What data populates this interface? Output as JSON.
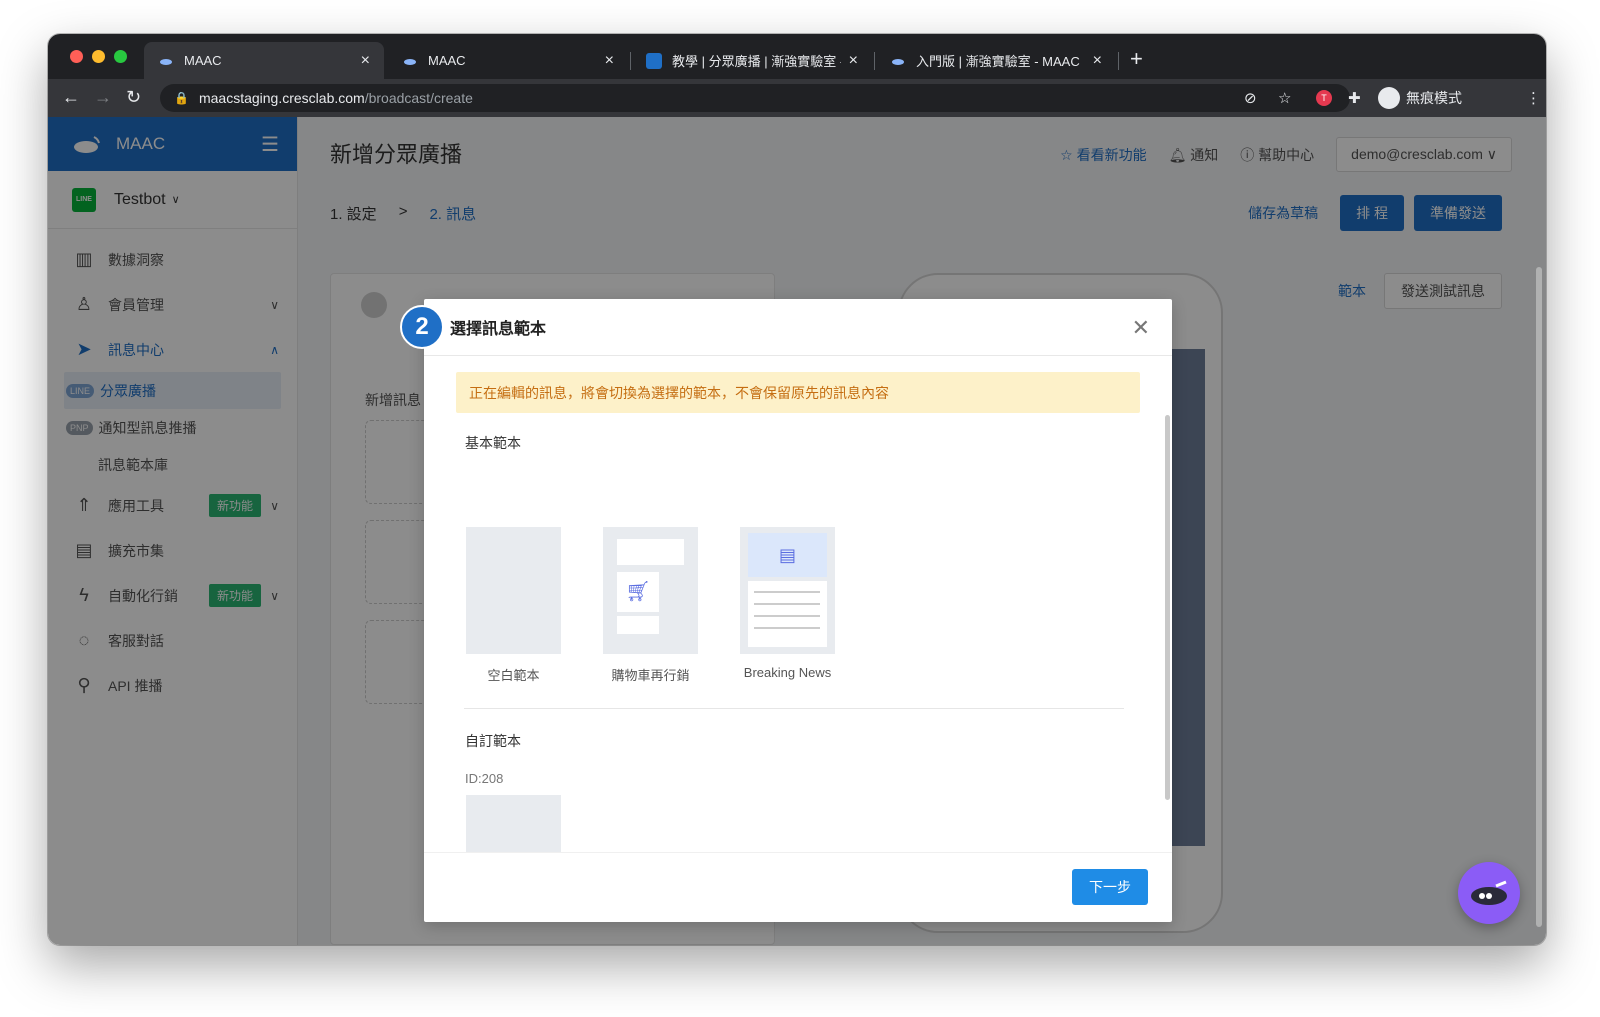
{
  "browser": {
    "tabs": [
      {
        "title": "MAAC"
      },
      {
        "title": "MAAC"
      },
      {
        "title": "教學 | 分眾廣播 | 漸強實驗室 - 鼠"
      },
      {
        "title": "入門版 | 漸強實驗室 - MAAC"
      }
    ],
    "url_host": "maacstaging.cresclab.com",
    "url_path": "/broadcast/create",
    "profile_label": "無痕模式"
  },
  "sidebar": {
    "brand": "MAAC",
    "bot_name": "Testbot",
    "line_badge": "LINE",
    "items": [
      {
        "label": "數據洞察"
      },
      {
        "label": "會員管理"
      },
      {
        "label": "訊息中心"
      },
      {
        "label": "應用工具",
        "badge": "新功能"
      },
      {
        "label": "擴充市集"
      },
      {
        "label": "自動化行銷",
        "badge": "新功能"
      },
      {
        "label": "客服對話"
      },
      {
        "label": "API 推播"
      }
    ],
    "sub_items": [
      {
        "badge": "LINE",
        "label": "分眾廣播"
      },
      {
        "badge": "PNP",
        "label": "通知型訊息推播"
      },
      {
        "label": "訊息範本庫"
      }
    ]
  },
  "header": {
    "title": "新增分眾廣播",
    "whats_new": "看看新功能",
    "notify": "通知",
    "help": "幫助中心",
    "account": "demo@cresclab.com"
  },
  "steps": {
    "step1": "1. 設定",
    "sep": ">",
    "step2": "2. 訊息",
    "save_draft": "儲存為草稿",
    "schedule": "排 程",
    "ready": "準備發送"
  },
  "preview": {
    "template_link": "範本",
    "send_test": "發送測試訊息"
  },
  "editor": {
    "label": "新增訊息"
  },
  "modal": {
    "step_number": "2",
    "title": "選擇訊息範本",
    "warning": "正在編輯的訊息，將會切換為選擇的範本，不會保留原先的訊息內容",
    "basic_title": "基本範本",
    "templates": [
      {
        "label": "空白範本"
      },
      {
        "label": "購物車再行銷"
      },
      {
        "label": "Breaking News"
      }
    ],
    "custom_title": "自訂範本",
    "custom_id": "ID:208",
    "next": "下一步"
  },
  "colors": {
    "primary": "#1f6fc6",
    "warning_bg": "#fdf1c9",
    "warning_text": "#c56e12",
    "new_badge": "#2bb673"
  }
}
